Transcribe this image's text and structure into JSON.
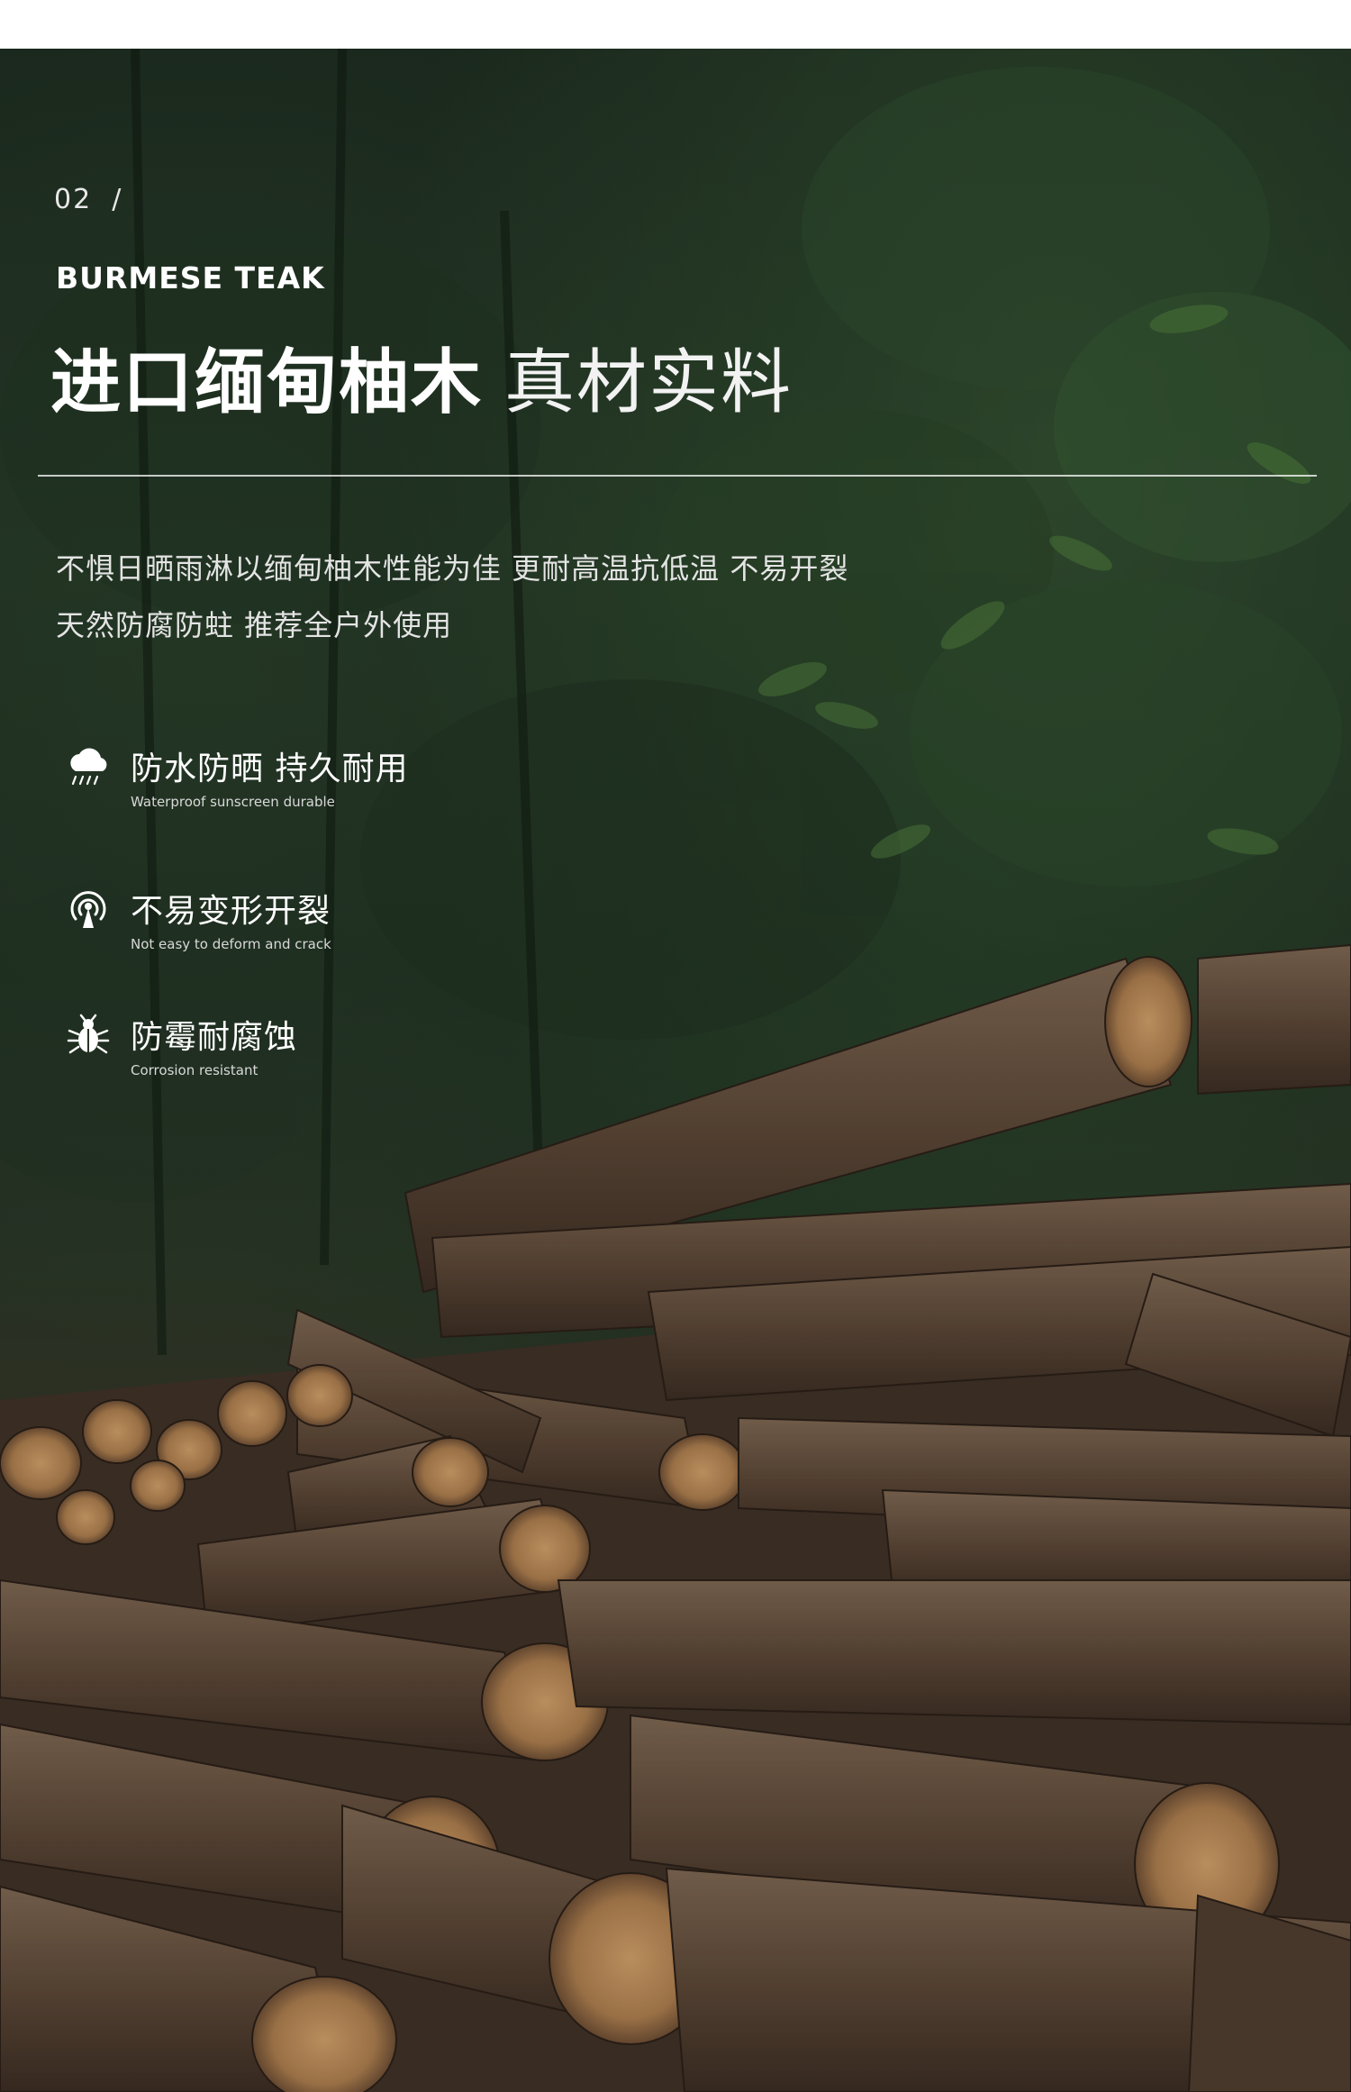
{
  "section": {
    "number": "02",
    "separator": "/",
    "eyebrow": "BURMESE TEAK"
  },
  "headline": {
    "bold": "进口缅甸柚木",
    "light": "真材实料"
  },
  "description": {
    "line1": "不惧日晒雨淋以缅甸柚木性能为佳 更耐高温抗低温 不易开裂",
    "line2": "天然防腐防蛀 推荐全户外使用"
  },
  "features": [
    {
      "icon": "cloud-rain-icon",
      "title": "防水防晒 持久耐用",
      "subtitle": "Waterproof sunscreen durable"
    },
    {
      "icon": "radar-signal-icon",
      "title": "不易变形开裂",
      "subtitle": "Not easy to deform and crack"
    },
    {
      "icon": "bug-icon",
      "title": "防霉耐腐蚀",
      "subtitle": "Corrosion resistant"
    }
  ],
  "colors": {
    "background_top": "#1c2a1f",
    "log_bark": "#5a4636",
    "log_end": "#b88a5a",
    "text": "#ffffff"
  }
}
